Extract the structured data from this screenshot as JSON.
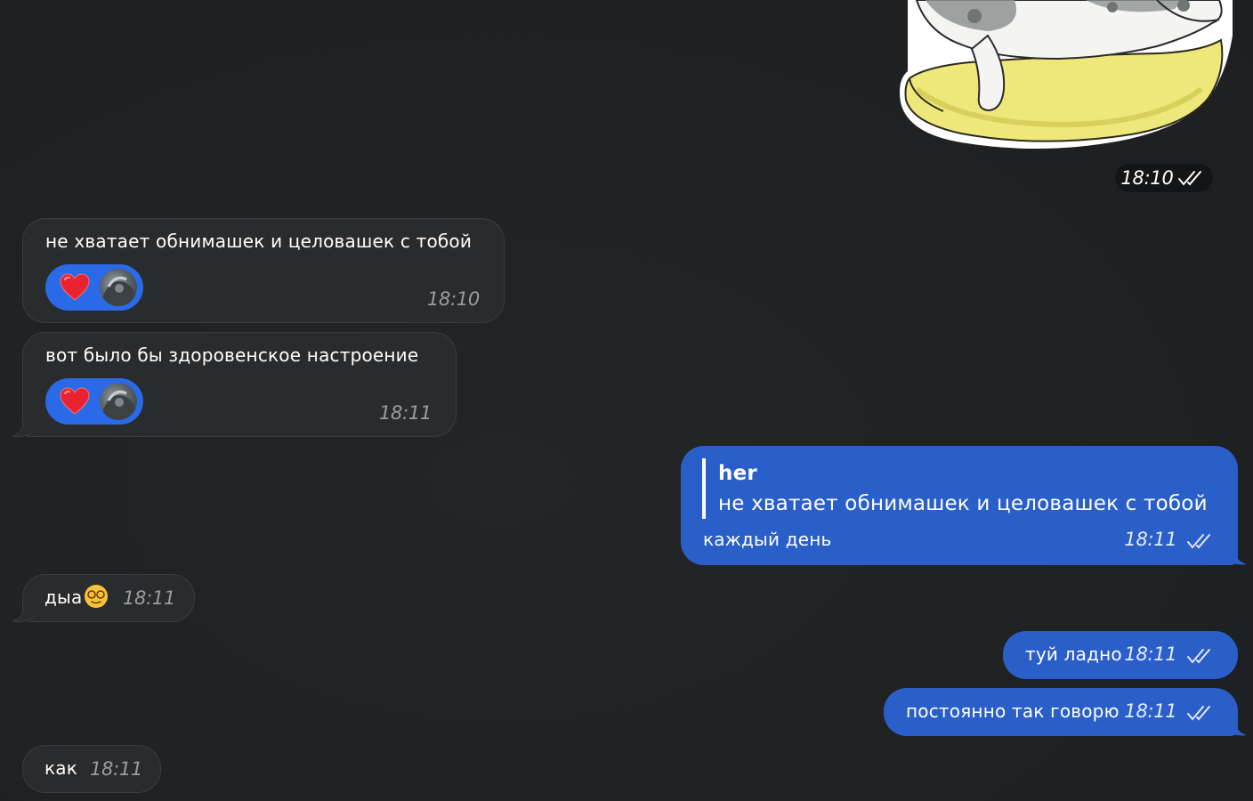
{
  "sticker": {
    "icon": "cat-on-banana-sticker",
    "time": "18:10"
  },
  "messages": [
    {
      "direction": "incoming",
      "text": "не хватает обнимашек и целовашек с тобой",
      "reaction": "❤️",
      "time": "18:10"
    },
    {
      "direction": "incoming",
      "text": "вот было бы здоровенское настроение",
      "reaction": "❤️",
      "time": "18:11"
    },
    {
      "direction": "outgoing",
      "reply_author": "her",
      "reply_text": "не хватает обнимашек и целовашек с тобой",
      "text": "каждый день",
      "time": "18:11"
    },
    {
      "direction": "incoming",
      "text": "дыа",
      "emoji": "😵‍💫",
      "time": "18:11"
    },
    {
      "direction": "outgoing",
      "text": "туй ладно",
      "time": "18:11"
    },
    {
      "direction": "outgoing",
      "text": "постоянно так говорю",
      "time": "18:11"
    },
    {
      "direction": "incoming",
      "text": "как",
      "time": "18:11"
    }
  ],
  "colors": {
    "background": "#1f2123",
    "incoming_bubble": "#2a2b2d",
    "outgoing_bubble": "#2a5fc9",
    "reaction_pill": "#2a6ae6"
  }
}
